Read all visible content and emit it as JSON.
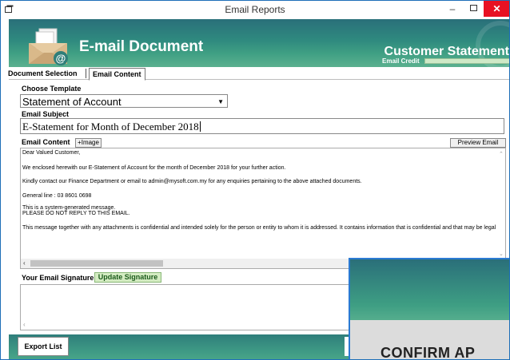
{
  "window": {
    "title": "Email Reports",
    "minimize": "–",
    "close": "✕"
  },
  "header": {
    "title": "E-mail Document",
    "customer_title": "Customer Statement",
    "credit_label": "Email Credit"
  },
  "tabs": [
    {
      "label": "Document Selection"
    },
    {
      "label": "Email Content"
    }
  ],
  "form": {
    "template_label": "Choose Template",
    "template_value": "Statement of Account",
    "subject_label": "Email Subject",
    "subject_value": "E-Statement for Month of December 2018",
    "content_label": "Email Content",
    "image_button": "+Image",
    "preview_button": "Preview Email"
  },
  "email_body": [
    "Dear Valued Customer,",
    "We enclosed herewith our E-Statement of Account for the month of December 2018 for your further action.",
    "Kindly contact our Finance Department or email to admin@mysoft.com.my for any enquiries pertaining to the above attached documents.",
    "General line : 03 8601 0698",
    "This is a system-generated message.",
    "PLEASE DO NOT REPLY TO THIS EMAIL.",
    "This message together with any attachments is confidential and intended solely for the person or entity to whom it is addressed. It contains information that is confidential and that may be legal"
  ],
  "signature": {
    "label": "Your Email Signature",
    "update_button": "Update Signature"
  },
  "footer": {
    "export_button": "Export List"
  },
  "dialog": {
    "title": "CONFIRM AP"
  },
  "colors": {
    "accent": "#3e9e83",
    "close": "#e81123",
    "dialog_border": "#2b7ad3"
  },
  "icons": [
    "app-icon",
    "envelope-icon",
    "chevron-down-icon",
    "chevron-up-icon",
    "chevron-left-icon"
  ]
}
